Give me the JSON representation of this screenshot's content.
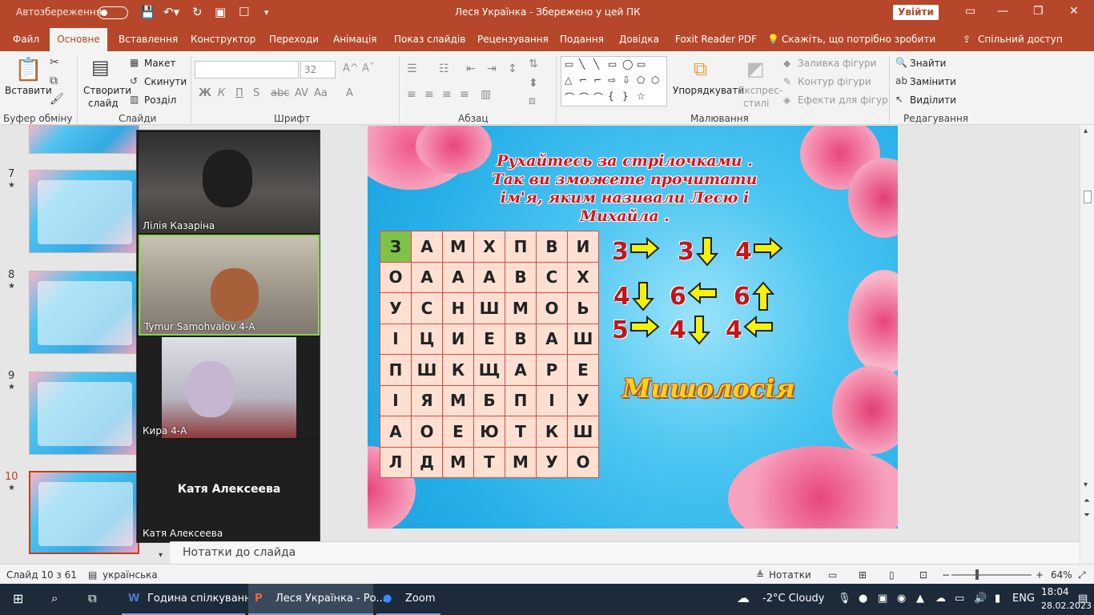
{
  "titlebar": {
    "autosave": "Автозбереження",
    "doc_title": "Леся Українка  -  Збережено у цей ПК",
    "signin": "Увійти"
  },
  "tabs": [
    "Файл",
    "Основне",
    "Вставлення",
    "Конструктор",
    "Переходи",
    "Анімація",
    "Показ слайдів",
    "Рецензування",
    "Подання",
    "Довідка",
    "Foxit Reader PDF",
    "Скажіть, що потрібно зробити",
    "Спільний доступ"
  ],
  "ribbon": {
    "paste": "Вставити",
    "new_slide": "Створити",
    "new_slide2": "слайд",
    "layout": "Макет",
    "reset": "Скинути",
    "section": "Розділ",
    "font_name": "",
    "font_size": "32",
    "arrange": "Упорядкувати",
    "quick_styles": "Експрес-",
    "quick_styles2": "стилі",
    "shape_fill": "Заливка фігури",
    "shape_outline": "Контур фігури",
    "shape_effects": "Ефекти для фігур",
    "find": "Знайти",
    "replace": "Замінити",
    "select": "Виділити",
    "groups": [
      "Буфер обміну",
      "Слайди",
      "Шрифт",
      "Абзац",
      "Малювання",
      "Редагування"
    ]
  },
  "thumbnails": [
    {
      "num": "7"
    },
    {
      "num": "8"
    },
    {
      "num": "9"
    },
    {
      "num": "10"
    }
  ],
  "zoom": {
    "participants": [
      "Лілія Казаріна",
      "Tymur Samohvalov 4-А",
      "Кира 4-А",
      "Катя Алексеева"
    ],
    "big_name": "Катя Алексеева"
  },
  "slide": {
    "title_lines": [
      "Рухайтесь за стрілочками .",
      "Так ви зможете прочитати",
      "ім'я, яким називали Лесю і",
      "Михайла ."
    ],
    "grid": [
      [
        "З",
        "А",
        "М",
        "Х",
        "П",
        "В",
        "И"
      ],
      [
        "О",
        "А",
        "А",
        "А",
        "В",
        "С",
        "Х"
      ],
      [
        "У",
        "С",
        "Н",
        "Ш",
        "М",
        "О",
        "Ь"
      ],
      [
        "І",
        "Ц",
        "И",
        "Е",
        "В",
        "А",
        "Ш"
      ],
      [
        "П",
        "Ш",
        "К",
        "Щ",
        "А",
        "Р",
        "Е"
      ],
      [
        "І",
        "Я",
        "М",
        "Б",
        "П",
        "І",
        "У"
      ],
      [
        "А",
        "О",
        "Е",
        "Ю",
        "Т",
        "К",
        "Ш"
      ],
      [
        "Л",
        "Д",
        "М",
        "Т",
        "М",
        "У",
        "О"
      ]
    ],
    "clues": [
      {
        "n": "3",
        "dir": "right"
      },
      {
        "n": "3",
        "dir": "down"
      },
      {
        "n": "4",
        "dir": "right"
      },
      {
        "n": "4",
        "dir": "down"
      },
      {
        "n": "6",
        "dir": "left"
      },
      {
        "n": "6",
        "dir": "up"
      },
      {
        "n": "5",
        "dir": "right"
      },
      {
        "n": "4",
        "dir": "down"
      },
      {
        "n": "4",
        "dir": "left"
      }
    ],
    "answer": "Мишолосія"
  },
  "notes_placeholder": "Нотатки до слайда",
  "status": {
    "slide": "Слайд 10 з 61",
    "lang": "українська",
    "notes": "Нотатки",
    "zoom": "64%"
  },
  "taskbar": {
    "apps": [
      "Година спілкуванн...",
      "Леся Українка - Ро...",
      "Zoom"
    ],
    "weather": "-2°C  Cloudy",
    "lang": "ENG",
    "time": "18:04",
    "date": "28.02.2023"
  }
}
